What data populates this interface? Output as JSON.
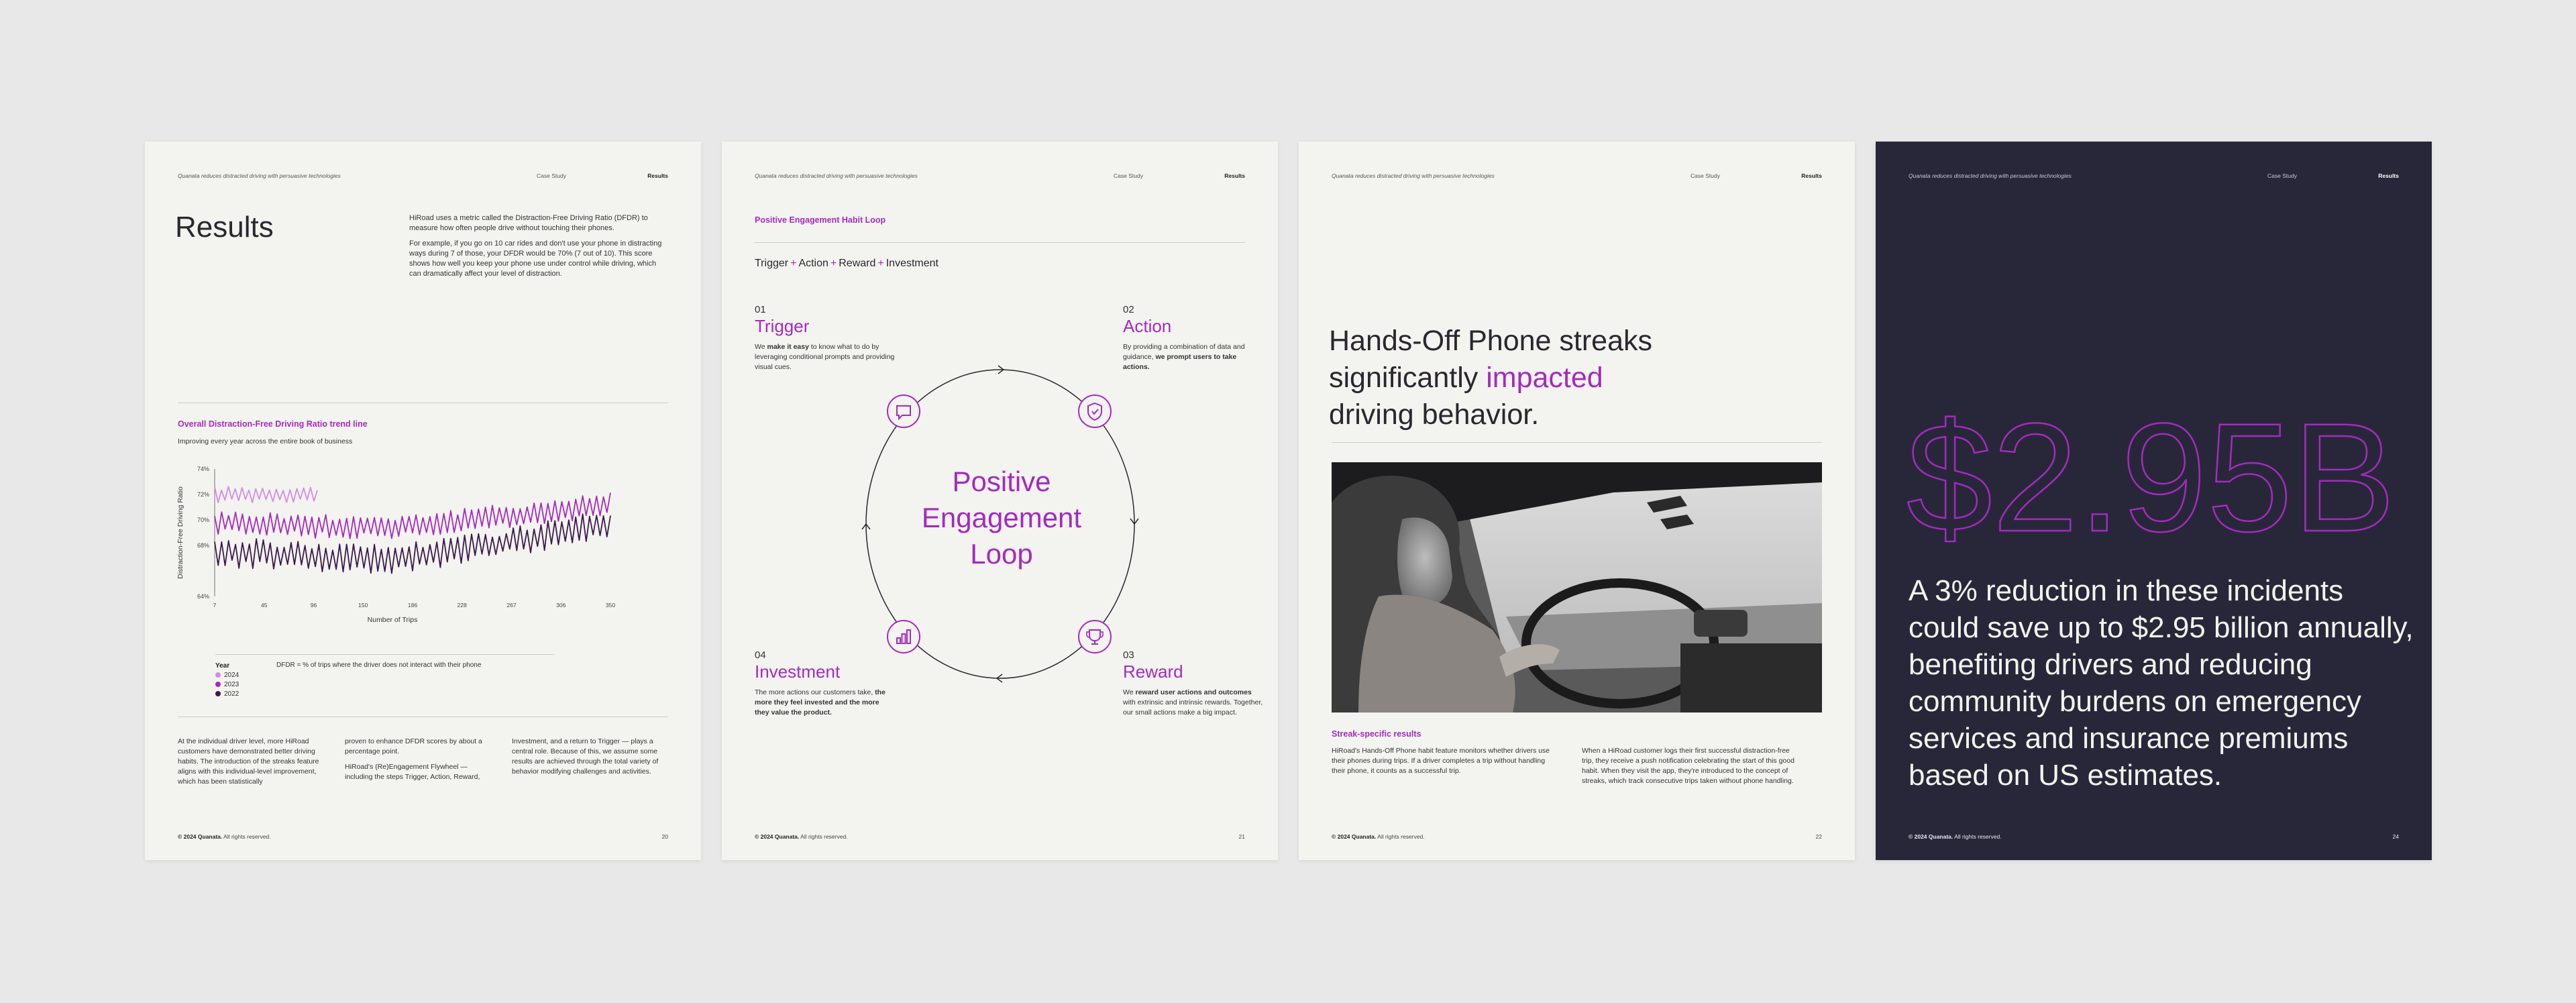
{
  "header": {
    "left": "Quanata reduces distracted driving with persuasive technologies",
    "middle": "Case Study",
    "right": "Results"
  },
  "footer": {
    "copyright_bold": "© 2024 Quanata.",
    "copyright_rest": " All rights reserved."
  },
  "colors": {
    "accent": "#a32bbd",
    "page": "#f3f3ef",
    "dark_page": "#28273a",
    "series_2024": "#d38ee0",
    "series_2023": "#a32bbd",
    "series_2022": "#3b1a4a"
  },
  "page1": {
    "title": "Results",
    "intro_p1": "HiRoad uses a metric called the Distraction-Free Driving Ratio (DFDR) to measure how often people drive without touching their phones.",
    "intro_p2": "For example, if you go on 10 car rides and don't use your phone in distracting ways during 7 of those, your DFDR would be 70% (7 out of 10). This score shows how well you keep your phone use under control while driving, which can dramatically affect your level of distraction.",
    "chart_title": "Overall Distraction-Free Driving Ratio trend line",
    "chart_subtitle": "Improving every year across the entire book of business",
    "legend_title": "Year",
    "legend_items": [
      "2024",
      "2023",
      "2022"
    ],
    "note": "DFDR = % of trips where the driver does not interact with their phone",
    "col1": "At the individual driver level, more HiRoad customers have demonstrated better driving habits. The introduction of the streaks feature aligns with this individual-level improvement, which has been statistically",
    "col2_p1": "proven to enhance DFDR scores by about a percentage point.",
    "col2_p2": "HiRoad's (Re)Engagement Flywheel — including the steps Trigger, Action, Reward,",
    "col3": "Investment, and a return to Trigger — plays a central role. Because of this, we assume some results are achieved through the total variety of behavior modifying challenges and activities.",
    "page_number": "20"
  },
  "chart_data": {
    "type": "line",
    "title": "Overall Distraction-Free Driving Ratio trend line",
    "subtitle": "Improving every year across the entire book of business",
    "xlabel": "Number of Trips",
    "ylabel": "Distraction-Free Driving Ratio",
    "x_ticks": [
      "7",
      "45",
      "96",
      "150",
      "186",
      "228",
      "267",
      "306",
      "350"
    ],
    "y_ticks": [
      "64%",
      "68%",
      "70%",
      "72%",
      "74%"
    ],
    "ylim": [
      64,
      74
    ],
    "xlim": [
      7,
      350
    ],
    "grid": false,
    "legend_placement": "bottom-left",
    "series": [
      {
        "name": "2024",
        "x_range": [
          7,
          96
        ],
        "mean": 72.0,
        "amplitude": 0.6,
        "trend": 0.0
      },
      {
        "name": "2023",
        "x_range": [
          7,
          350
        ],
        "mean": 69.8,
        "amplitude": 0.9,
        "trend": 1.2
      },
      {
        "name": "2022",
        "x_range": [
          7,
          350
        ],
        "mean": 67.5,
        "amplitude": 1.1,
        "trend": 1.8
      }
    ]
  },
  "page2": {
    "section_title": "Positive Engagement Habit Loop",
    "formula": [
      "Trigger",
      "Action",
      "Reward",
      "Investment"
    ],
    "plus": "+",
    "loop_title_lines": [
      "Positive",
      "Engagement",
      "Loop"
    ],
    "steps": [
      {
        "num": "01",
        "name": "Trigger",
        "bold1": "make it easy",
        "t0": "We ",
        "t1": " to know what to do by leveraging conditional prompts and providing visual cues."
      },
      {
        "num": "02",
        "name": "Action",
        "t0": "By providing a combination of data and guidance, ",
        "bold1": "we prompt users to take actions."
      },
      {
        "num": "03",
        "name": "Reward",
        "t0": "We ",
        "bold1": "reward user actions and outcomes",
        "t1": " with extrinsic and intrinsic rewards. Together, our small actions make a big impact."
      },
      {
        "num": "04",
        "name": "Investment",
        "t0": "The more actions our customers take, ",
        "bold1": "the more they feel invested and the more they value the product."
      }
    ],
    "icons": [
      "chat-icon",
      "shield-check-icon",
      "trophy-icon",
      "bar-chart-icon"
    ],
    "page_number": "21"
  },
  "page3": {
    "headline_1": "Hands-Off Phone streaks",
    "headline_2a": "significantly ",
    "headline_2b": "impacted",
    "headline_3": "driving behavior.",
    "subtitle": "Streak-specific results",
    "col1": "HiRoad's Hands-Off Phone habit feature monitors whether drivers use their phones during trips. If a driver completes a trip without handling their phone, it counts as a successful trip.",
    "col2": "When a HiRoad customer logs their first successful distraction-free trip, they receive a push notification celebrating the start of this good habit. When they visit the app, they're introduced to the concept of streaks, which track consecutive trips taken without phone handling.",
    "page_number": "22"
  },
  "page4": {
    "big_number": "$2.95B",
    "statement": "A 3% reduction in these incidents could save up to $2.95 billion annually, benefiting drivers and reducing community burdens on emergency services and insurance premiums based on US estimates.",
    "page_number": "24"
  }
}
